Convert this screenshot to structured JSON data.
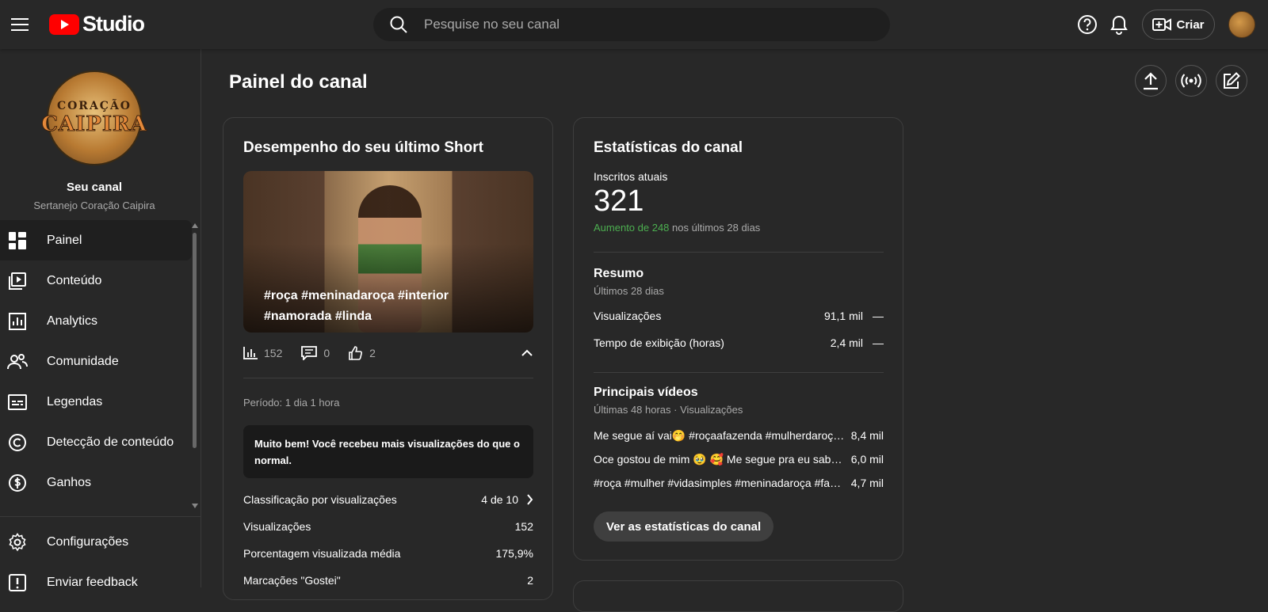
{
  "header": {
    "logo_text": "Studio",
    "search_placeholder": "Pesquise no seu canal",
    "create_label": "Criar"
  },
  "sidebar": {
    "channel_logo_line1": "CORAÇÃO",
    "channel_logo_line2": "CAIPIRA",
    "channel_label": "Seu canal",
    "channel_name": "Sertanejo Coração Caipira",
    "items": [
      {
        "label": "Painel",
        "icon": "dashboard-icon"
      },
      {
        "label": "Conteúdo",
        "icon": "content-icon"
      },
      {
        "label": "Analytics",
        "icon": "analytics-icon"
      },
      {
        "label": "Comunidade",
        "icon": "community-icon"
      },
      {
        "label": "Legendas",
        "icon": "subtitles-icon"
      },
      {
        "label": "Detecção de conteúdo",
        "icon": "copyright-icon"
      },
      {
        "label": "Ganhos",
        "icon": "earn-icon"
      }
    ],
    "bottom_items": [
      {
        "label": "Configurações",
        "icon": "gear-icon"
      },
      {
        "label": "Enviar feedback",
        "icon": "feedback-icon"
      }
    ]
  },
  "main": {
    "title": "Painel do canal"
  },
  "short_card": {
    "title": "Desempenho do seu último Short",
    "caption": "#roça #meninadaroça #interior #namorada #linda",
    "views": "152",
    "comments": "0",
    "likes": "2",
    "period": "Período: 1 dia 1 hora",
    "message": "Muito bem! Você recebeu mais visualizações do que o normal.",
    "metrics": [
      {
        "label": "Classificação por visualizações",
        "value": "4 de 10"
      },
      {
        "label": "Visualizações",
        "value": "152"
      },
      {
        "label": "Porcentagem visualizada média",
        "value": "175,9%"
      },
      {
        "label": "Marcações \"Gostei\"",
        "value": "2"
      }
    ]
  },
  "stats_card": {
    "title": "Estatísticas do canal",
    "subs_label": "Inscritos atuais",
    "subs_value": "321",
    "growth_highlight": "Aumento de 248",
    "growth_rest": " nos últimos 28 dias",
    "summary_title": "Resumo",
    "summary_period": "Últimos 28 dias",
    "summary_rows": [
      {
        "label": "Visualizações",
        "value": "91,1 mil",
        "trend": "—"
      },
      {
        "label": "Tempo de exibição (horas)",
        "value": "2,4 mil",
        "trend": "—"
      }
    ],
    "top_title": "Principais vídeos",
    "top_period": "Últimas 48 horas · Visualizações",
    "top_videos": [
      {
        "title": "Me segue aí vai🤭 #roçaafazenda #mulherdaroça #mulherdaroça",
        "value": "8,4 mil"
      },
      {
        "title": "Oce gostou de mim 🥹 🥰 Me segue pra eu saber que gostou",
        "value": "6,0 mil"
      },
      {
        "title": "#roça #mulher #vidasimples #meninadaroça #fazenda",
        "value": "4,7 mil"
      }
    ],
    "button_label": "Ver as estatísticas do canal"
  }
}
